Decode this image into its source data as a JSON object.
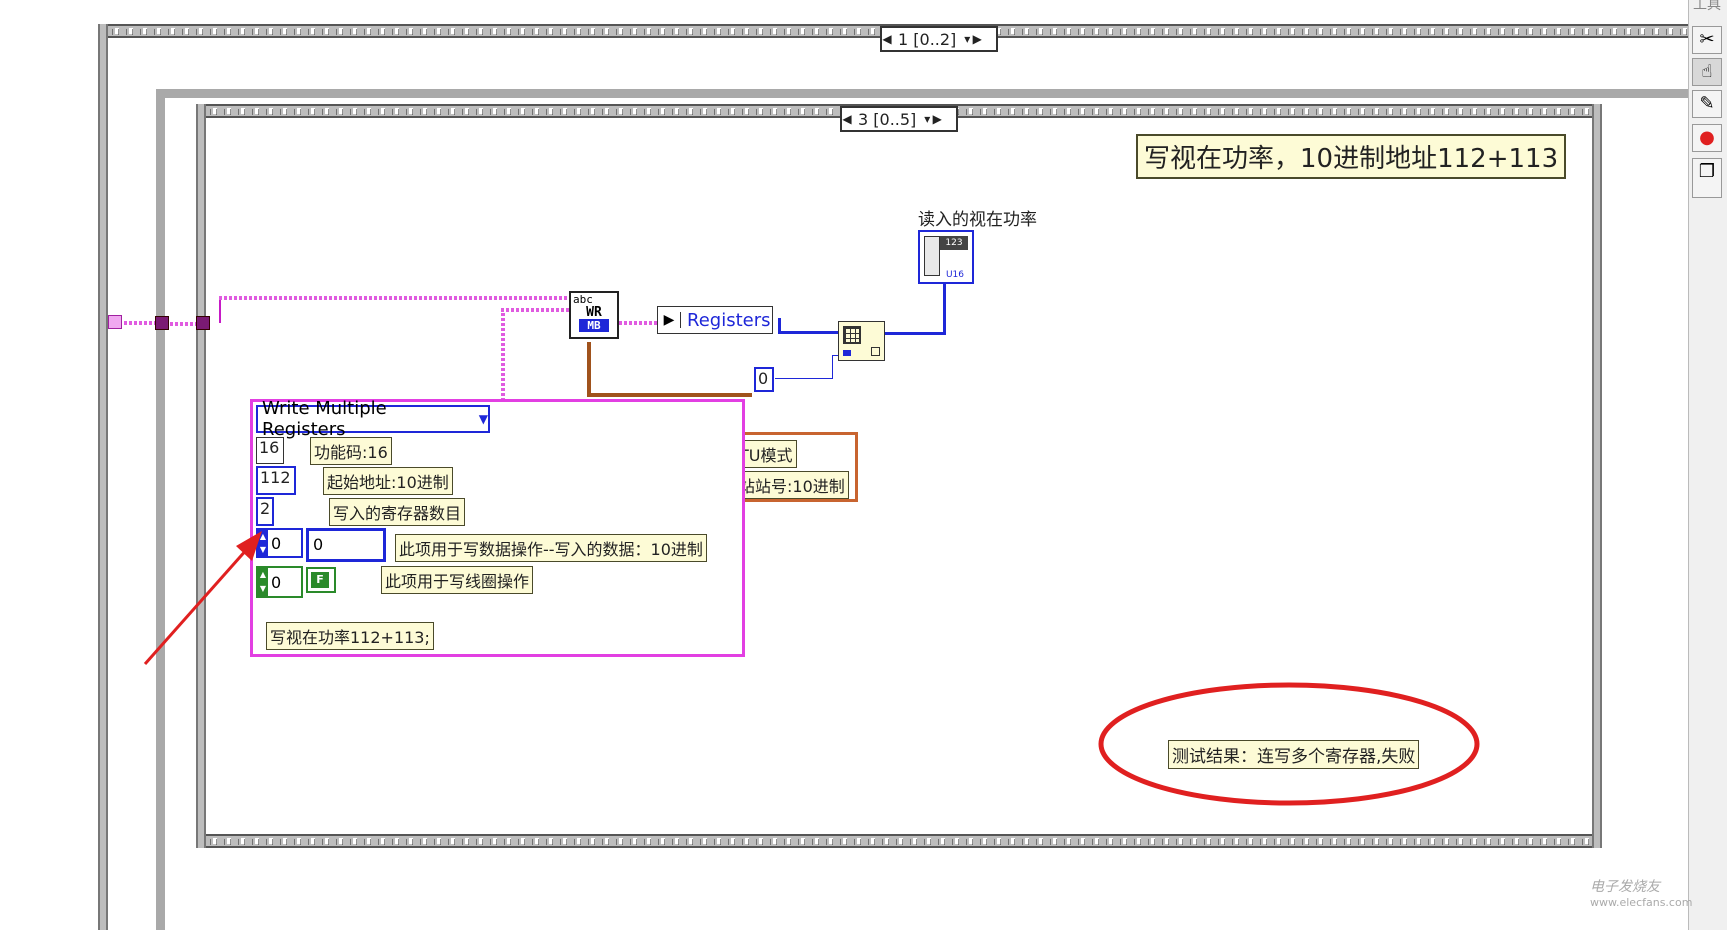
{
  "outer_sequence": {
    "frame_selector": "1 [0..2]"
  },
  "inner_sequence": {
    "frame_selector": "3 [0..5]"
  },
  "title_comment": "写视在功率，10进制地址112+113",
  "indicator": {
    "label": "读入的视在功率",
    "sub_label": "U16"
  },
  "registers_constant": "Registers",
  "index_constant": "0",
  "write_vi": {
    "icon_lines": [
      "abc",
      "WR",
      "MB"
    ]
  },
  "cluster": {
    "function_dropdown": "Write Multiple Registers",
    "function_code": {
      "value": "16",
      "comment": "功能码:16"
    },
    "start_address": {
      "value": "112",
      "comment": "起始地址:10进制"
    },
    "register_count": {
      "value": "2",
      "comment": "写入的寄存器数目"
    },
    "data_array": {
      "index": "0",
      "value": "0",
      "comment": "此项用于写数据操作--写入的数据：10进制"
    },
    "coil_array": {
      "index": "0",
      "value": "F",
      "comment": "此项用于写线圈操作"
    },
    "footer_comment": "写视在功率112+113;"
  },
  "hidden_cluster": {
    "line1": "TU模式",
    "line2": "站站号:10进制"
  },
  "result_comment": "测试结果：连写多个寄存器,失败",
  "palette_header": "工具",
  "watermark": {
    "line1": "电子发烧友",
    "line2": "www.elecfans.com"
  },
  "colors": {
    "string_wire": "#c61ac6",
    "numeric_wire": "#1e27d8",
    "error_wire": "#a0521c",
    "annotation_red": "#e02020"
  }
}
